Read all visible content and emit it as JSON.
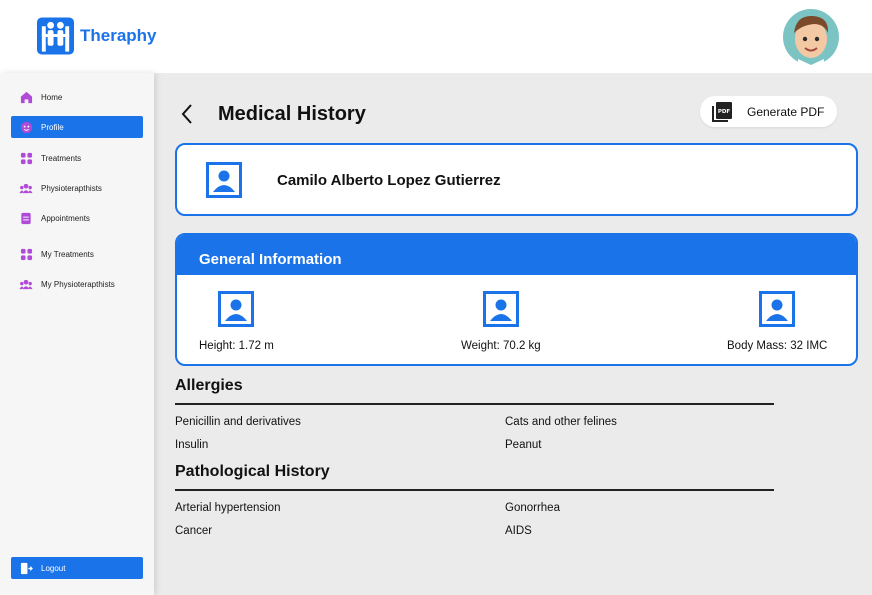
{
  "brand": {
    "name": "Theraphy",
    "accent": "#1a73e8"
  },
  "sidebar": {
    "items": [
      {
        "label": "Home",
        "icon": "home-icon",
        "active": false
      },
      {
        "label": "Profile",
        "icon": "face-icon",
        "active": true
      },
      {
        "label": "Treatments",
        "icon": "grid-icon",
        "active": false
      },
      {
        "label": "Physioterapthists",
        "icon": "group-icon",
        "active": false
      },
      {
        "label": "Appointments",
        "icon": "document-icon",
        "active": false
      },
      {
        "label": "My Treatments",
        "icon": "grid-icon",
        "active": false
      },
      {
        "label": "My Physioterapthists",
        "icon": "group-icon",
        "active": false
      }
    ],
    "logout_label": "Logout"
  },
  "header": {
    "title": "Medical History",
    "pdf_button": "Generate PDF"
  },
  "patient": {
    "name": "Camilo Alberto Lopez Gutierrez"
  },
  "general_info": {
    "title": "General Information",
    "height": "Height: 1.72 m",
    "weight": "Weight: 70.2 kg",
    "body_mass": "Body Mass: 32 IMC"
  },
  "allergies": {
    "title": "Allergies",
    "items": [
      "Penicillin and derivatives",
      "Cats and other felines",
      "Insulin",
      "Peanut"
    ]
  },
  "pathological": {
    "title": "Pathological History",
    "items": [
      "Arterial hypertension",
      "Gonorrhea",
      "Cancer",
      "AIDS"
    ]
  }
}
